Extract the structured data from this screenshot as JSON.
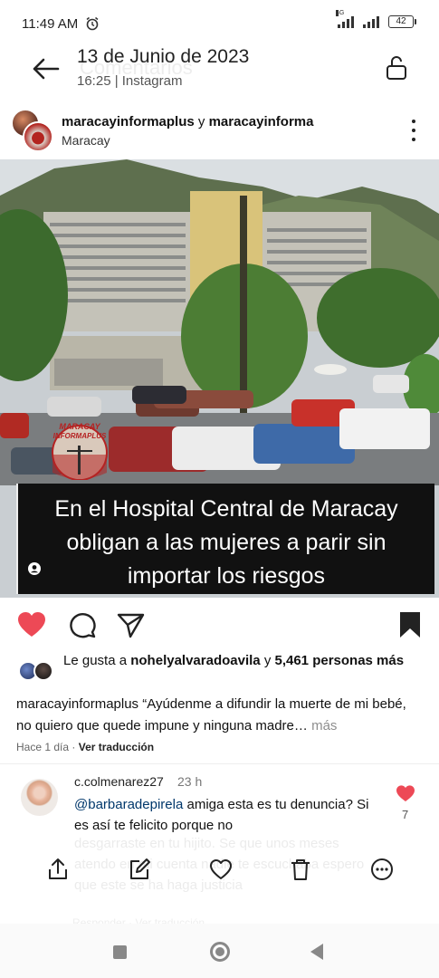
{
  "status_bar": {
    "time": "11:49 AM",
    "network": "4G",
    "battery": "42",
    "icons": [
      "alarm-icon",
      "signal-icon",
      "battery-icon"
    ]
  },
  "header": {
    "date": "13 de Junio de 2023",
    "subtitle": "16:25 | Instagram",
    "ghost_title": "Comentarios",
    "icons": [
      "back-arrow-icon",
      "unlock-icon"
    ]
  },
  "post": {
    "user1": "maracayinformaplus",
    "joiner": "y",
    "user2": "maracayinforma",
    "location": "Maracay",
    "image_caption": "En el Hospital Central de Maracay obligan a las mujeres a parir sin importar los riesgos",
    "logo_text_1": "MARACAY",
    "logo_text_2": "INFORMAPLUS"
  },
  "actions": {
    "icons": [
      "heart-icon",
      "comment-icon",
      "share-icon",
      "bookmark-icon"
    ],
    "liked_color": "#ed4956"
  },
  "likes": {
    "prefix": "Le gusta a",
    "user": "nohelyalvaradoavila",
    "connector": "y",
    "count": "5,461 personas más"
  },
  "description": {
    "user": "maracayinformaplus",
    "text": "“Ayúdenme a difundir la muerte de mi bebé, no quiero que quede impune y ninguna madre…",
    "more": "más"
  },
  "meta": {
    "time": "Hace 1 día",
    "separator": "·",
    "translate": "Ver traducción"
  },
  "comment": {
    "user": "c.colmenarez27",
    "time": "23 h",
    "mention": "@barbaradepirela",
    "text": "amiga esta es tu denuncia? Si es así te felicito porque no",
    "likes": "7",
    "ghost_text": "desgarraste en tu hijito. Se que unos meses atendo en mi cuenta nadie te escuchaba espero que este se ha haga justicia",
    "ghost_footer": "Responder · Ver traducción"
  },
  "toolbar": {
    "icons": [
      "share-out-icon",
      "edit-icon",
      "favorite-icon",
      "delete-icon",
      "more-options-icon"
    ]
  },
  "navbar": {
    "icons": [
      "recents-icon",
      "home-icon",
      "back-icon"
    ]
  }
}
